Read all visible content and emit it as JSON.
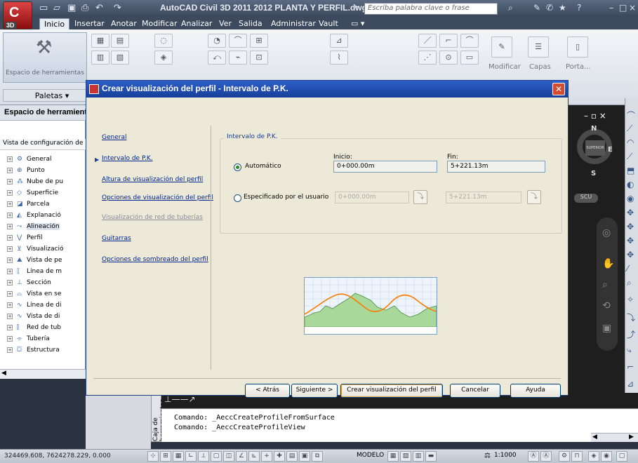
{
  "window": {
    "title": "AutoCAD Civil 3D 2011    2012 PLANTA Y PERFIL.dwg",
    "search_placeholder": "Escriba palabra clave o frase",
    "logo_version": "3D"
  },
  "ribbon_tabs": [
    "Inicio",
    "Insertar",
    "Anotar",
    "Modificar",
    "Analizar",
    "Ver",
    "Salida",
    "Administrar",
    "Vault"
  ],
  "ribbon": {
    "tool_palettes_label": "Espacio de herramientas",
    "palettes_label": "Paletas",
    "modify_label": "Modificar",
    "layers_label": "Capas",
    "clipboard_label": "Porta..."
  },
  "toolspace": {
    "header": "Espacio de herramientas",
    "view_label": "Vista de configuración de",
    "items": [
      "General",
      "Punto",
      "Nube de pu",
      "Superficie",
      "Parcela",
      "Explanació",
      "Alineación",
      "Perfil",
      "Visualizació",
      "Vista de pe",
      "Línea de m",
      "Sección",
      "Vista en se",
      "Línea de di",
      "Vista de di",
      "Red de tub",
      "Tubería",
      "Estructura"
    ],
    "side_label": "Caja de herramientas"
  },
  "dialog": {
    "title": "Crear visualización del perfil - Intervalo de P.K.",
    "nav": [
      "General",
      "Intervalo de P.K.",
      "Altura de visualización del perfil",
      "Opciones de visualización del perfil",
      "Visualización de red de tuberías",
      "Guitarras",
      "Opciones de sombreado del perfil"
    ],
    "group_label": "Intervalo de P.K.",
    "start_label": "Inicio:",
    "end_label": "Fin:",
    "auto_label": "Automático",
    "auto_start": "0+000.00m",
    "auto_end": "5+221.13m",
    "user_label": "Especificado por el usuario",
    "user_start": "0+000.00m",
    "user_end": "5+221.13m",
    "buttons": {
      "back": "< Atrás",
      "next": "Siguiente >",
      "create": "Crear visualización del perfil",
      "cancel": "Cancelar",
      "help": "Ayuda"
    }
  },
  "viewcube": {
    "north": "N",
    "south": "S",
    "east": "E",
    "face": "SUPERIOR",
    "ucs": "SCU"
  },
  "command": {
    "line1": "Comando:  _AeccCreateProfileFromSurface",
    "line2": "Comando:  _AeccCreateProfileView"
  },
  "status": {
    "coords": "324469.608, 7624278.229, 0.000",
    "model": "MODELO",
    "scale": "1:1000"
  }
}
